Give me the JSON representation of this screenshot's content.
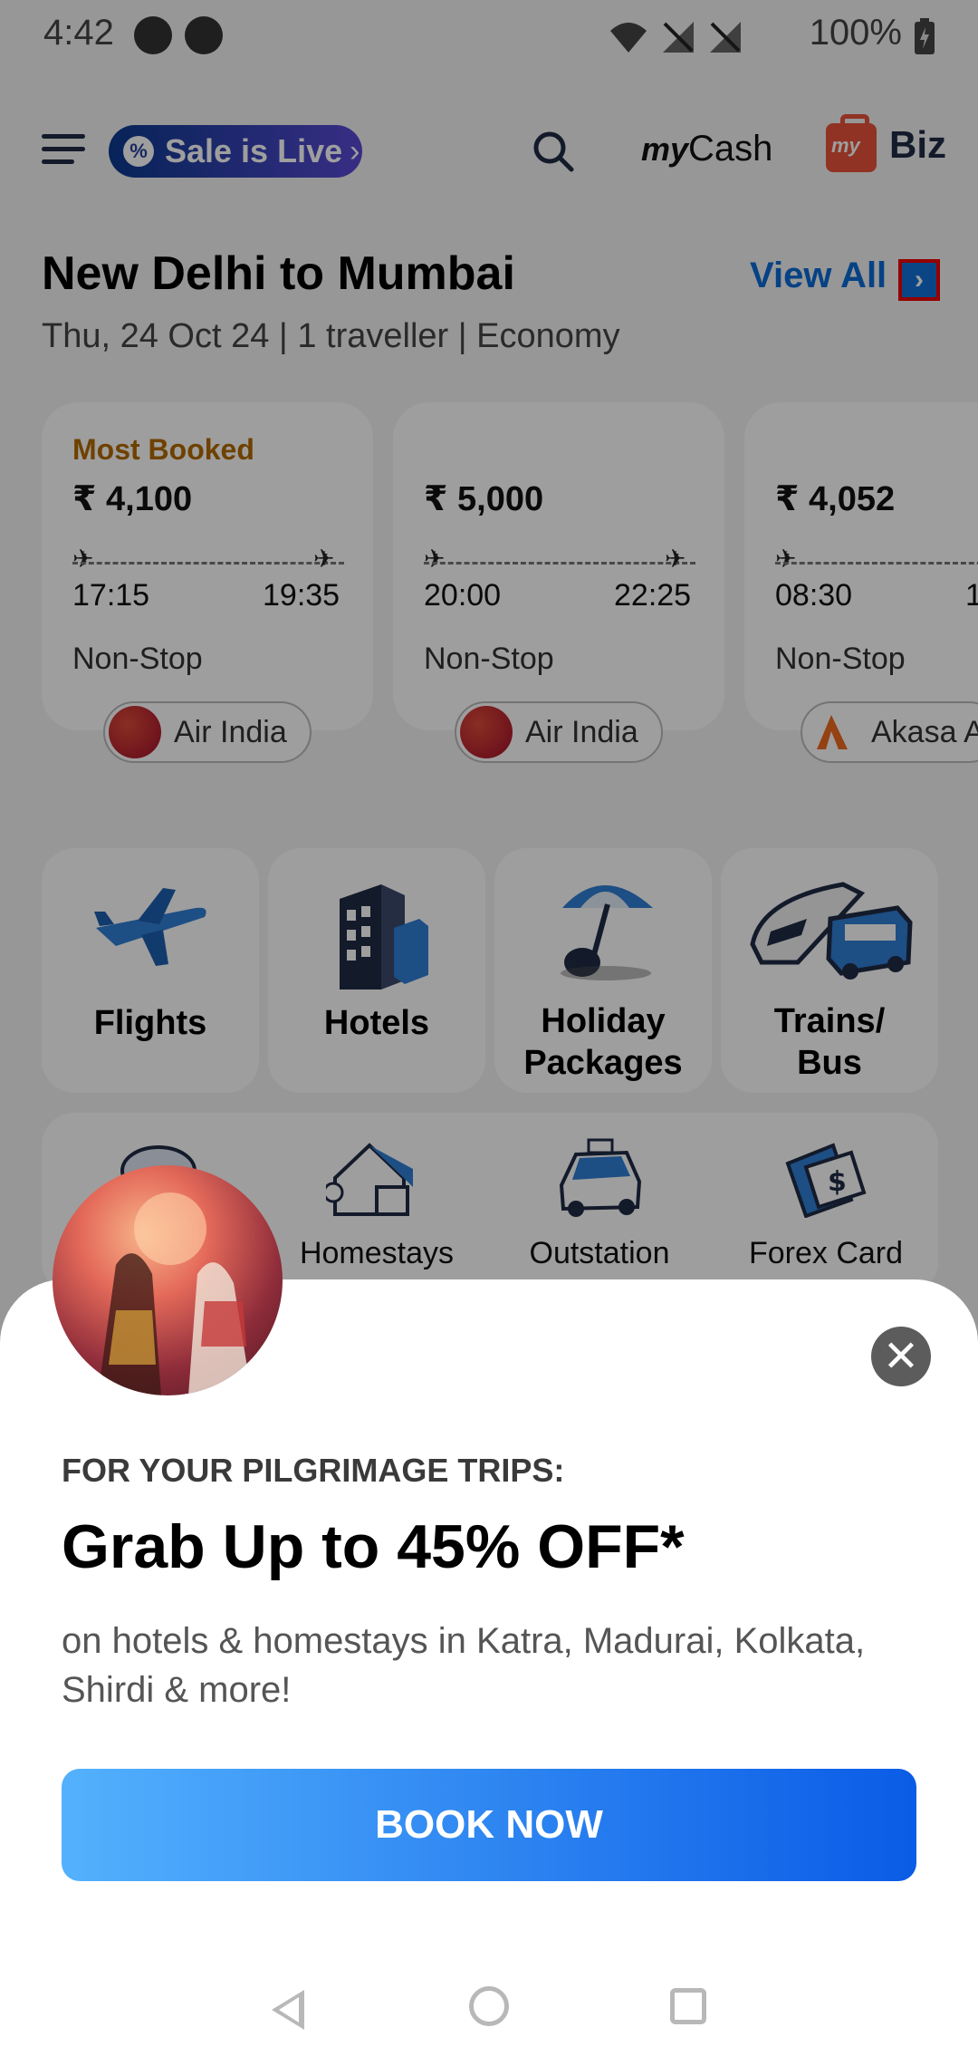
{
  "status_bar": {
    "time": "4:42",
    "battery": "100%"
  },
  "header": {
    "sale_label": "Sale is Live",
    "mycash_prefix": "my",
    "mycash_label": "Cash",
    "biz_label": "Biz",
    "biz_logo_text": "my"
  },
  "route": {
    "title": "New Delhi to Mumbai",
    "subtitle": "Thu, 24 Oct 24 | 1 traveller | Economy",
    "view_all": "View All"
  },
  "flights": [
    {
      "tag": "Most Booked",
      "price": "₹ 4,100",
      "dep": "17:15",
      "arr": "19:35",
      "stops": "Non-Stop",
      "airline": "Air India"
    },
    {
      "tag": "",
      "price": "₹ 5,000",
      "dep": "20:00",
      "arr": "22:25",
      "stops": "Non-Stop",
      "airline": "Air India"
    },
    {
      "tag": "",
      "price": "₹ 4,052",
      "dep": "08:30",
      "arr": "1",
      "stops": "Non-Stop",
      "airline": "Akasa A"
    }
  ],
  "categories": [
    {
      "label": "Flights"
    },
    {
      "label": "Hotels"
    },
    {
      "label": "Holiday Packages",
      "line1": "Holiday",
      "line2": "Packages"
    },
    {
      "label": "Trains/ Bus",
      "line1": "Trains/",
      "line2": "Bus"
    }
  ],
  "secondary": [
    {
      "label": "Homestays"
    },
    {
      "label": "Outstation"
    },
    {
      "label": "Forex Card"
    }
  ],
  "promo": {
    "kicker": "FOR YOUR PILGRIMAGE TRIPS:",
    "headline": "Grab Up to 45% OFF*",
    "description": "on hotels & homestays in Katra, Madurai, Kolkata, Shirdi & more!",
    "cta": "BOOK NOW"
  },
  "colors": {
    "accent_blue": "#0a6bd6",
    "tag_orange": "#b26a00",
    "cta_start": "#53b1fd",
    "cta_end": "#0a5ce6"
  }
}
